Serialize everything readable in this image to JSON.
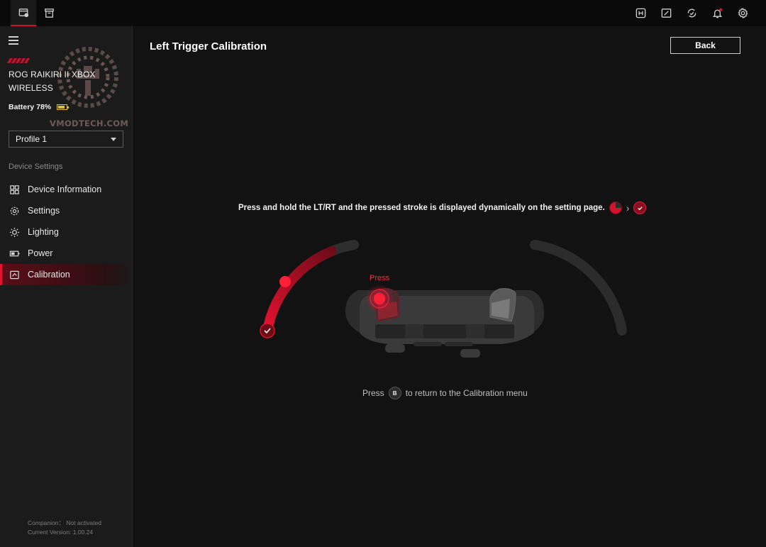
{
  "topbar": {
    "left_icons": [
      "device-icon",
      "store-icon"
    ],
    "right_icons": [
      "h-badge-icon",
      "edit-screen-icon",
      "sync-icon",
      "notification-bell-icon",
      "settings-gear-icon"
    ],
    "accent_color": "#d0102a"
  },
  "sidebar": {
    "device_name": "ROG RAIKIRI II XBOX WIRELESS",
    "battery_label": "Battery 78%",
    "battery_level": 0.78,
    "watermark_text": "VMODTECH.COM",
    "profile_selected": "Profile 1",
    "section_label": "Device Settings",
    "items": [
      {
        "label": "Device Information",
        "icon": "grid-icon",
        "active": false
      },
      {
        "label": "Settings",
        "icon": "gear-icon",
        "active": false
      },
      {
        "label": "Lighting",
        "icon": "sun-icon",
        "active": false
      },
      {
        "label": "Power",
        "icon": "battery-icon",
        "active": false
      },
      {
        "label": "Calibration",
        "icon": "calibration-icon",
        "active": true
      }
    ],
    "footer": {
      "companion": "Companion： Not activated",
      "version": "Current Version: 1.00.24"
    }
  },
  "main": {
    "title": "Left Trigger Calibration",
    "back_label": "Back",
    "instruction": "Press and hold the LT/RT and the pressed stroke is displayed dynamically on the setting page.",
    "press_label": "Press",
    "return_prefix": "Press",
    "return_button": "B",
    "return_suffix": "to return to the Calibration menu",
    "left_trigger_stroke": 0.82,
    "right_trigger_stroke": 0,
    "colors": {
      "active": "#d4122c",
      "inactive": "#2e2e2e"
    }
  }
}
